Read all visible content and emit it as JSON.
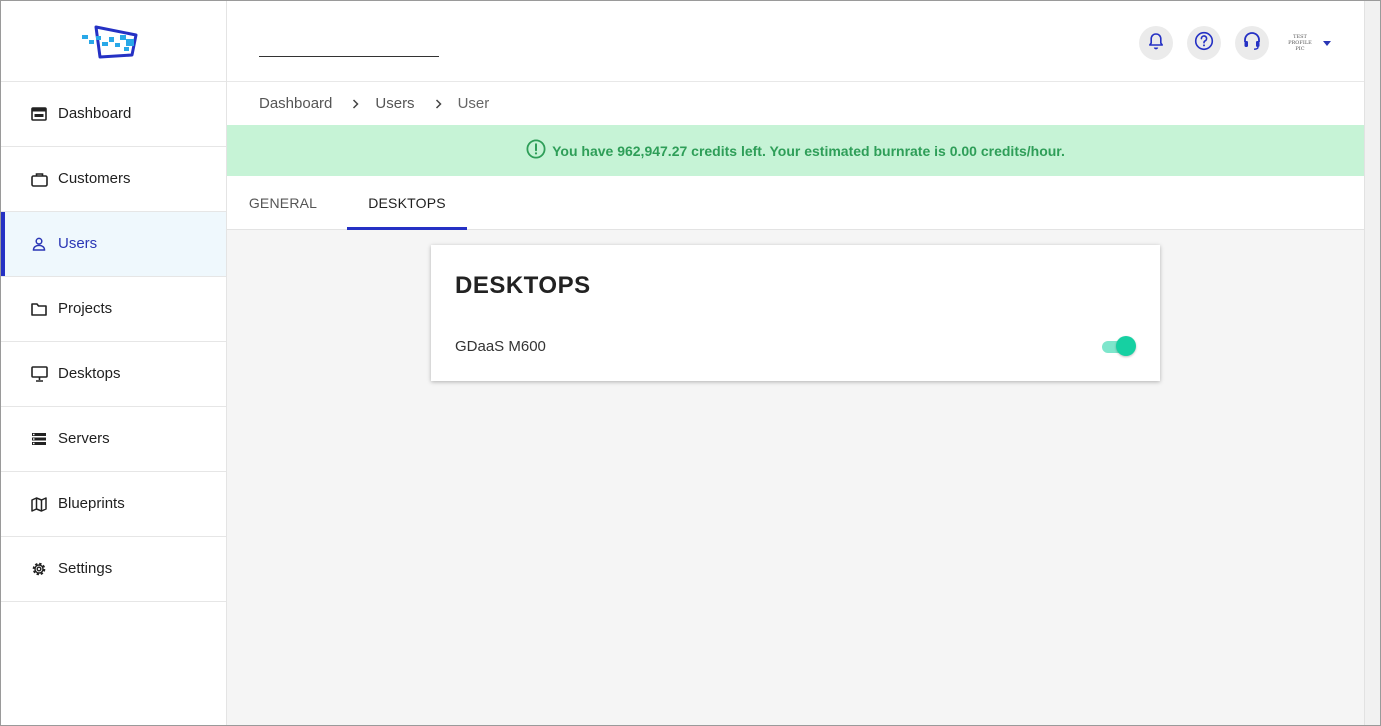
{
  "sidebar": {
    "items": [
      {
        "label": "Dashboard",
        "icon": "dashboard-icon"
      },
      {
        "label": "Customers",
        "icon": "briefcase-icon"
      },
      {
        "label": "Users",
        "icon": "user-icon",
        "active": true
      },
      {
        "label": "Projects",
        "icon": "folder-icon"
      },
      {
        "label": "Desktops",
        "icon": "monitor-icon"
      },
      {
        "label": "Servers",
        "icon": "server-icon"
      },
      {
        "label": "Blueprints",
        "icon": "map-icon"
      },
      {
        "label": "Settings",
        "icon": "gear-icon"
      }
    ]
  },
  "header": {
    "profile_text": "TEST PROFILE PIC",
    "icons": [
      "bell-icon",
      "help-icon",
      "headset-icon"
    ]
  },
  "breadcrumb": {
    "items": [
      "Dashboard",
      "Users",
      "User"
    ]
  },
  "banner": {
    "message": "You have 962,947.27 credits left. Your estimated burnrate is 0.00 credits/hour."
  },
  "tabs": [
    {
      "label": "GENERAL",
      "active": false
    },
    {
      "label": "DESKTOPS",
      "active": true
    }
  ],
  "card": {
    "title": "DESKTOPS",
    "rows": [
      {
        "label": "GDaaS M600",
        "enabled": true
      }
    ]
  },
  "colors": {
    "accent": "#2531c4",
    "banner_bg": "#c6f3d6",
    "banner_text": "#2e9e58",
    "toggle_on": "#16d0a2"
  }
}
